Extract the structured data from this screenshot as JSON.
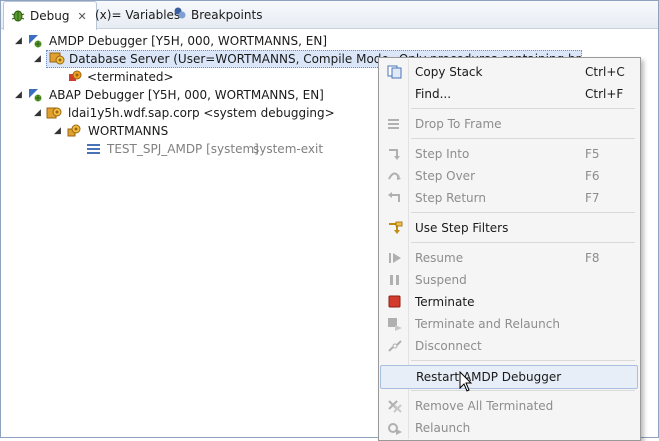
{
  "tabs": [
    {
      "label": "Debug",
      "active": true
    },
    {
      "label": "(x)= Variables",
      "active": false
    },
    {
      "label": "Breakpoints",
      "active": false
    }
  ],
  "tree": {
    "amdp_debugger": "AMDP Debugger [Y5H, 000, WORTMANNS, EN]",
    "database_server": "Database Server (User=WORTMANNS, Compile Mode=Only procedures containing breakpoints)",
    "terminated": "<terminated>",
    "abap_debugger": "ABAP Debugger [Y5H, 000, WORTMANNS, EN]",
    "host": "ldai1y5h.wdf.sap.corp <system debugging>",
    "user_node": "WORTMANNS",
    "frame_name": "TEST_SPJ_AMDP [system]",
    "frame_status": "system-exit"
  },
  "menu": {
    "copy_stack": {
      "label": "Copy Stack",
      "accel": "Ctrl+C"
    },
    "find": {
      "label": "Find...",
      "accel": "Ctrl+F"
    },
    "drop_to_frame": {
      "label": "Drop To Frame"
    },
    "step_into": {
      "label": "Step Into",
      "accel": "F5"
    },
    "step_over": {
      "label": "Step Over",
      "accel": "F6"
    },
    "step_return": {
      "label": "Step Return",
      "accel": "F7"
    },
    "use_step_filters": {
      "label": "Use Step Filters"
    },
    "resume": {
      "label": "Resume",
      "accel": "F8"
    },
    "suspend": {
      "label": "Suspend"
    },
    "terminate": {
      "label": "Terminate"
    },
    "terminate_relaunch": {
      "label": "Terminate and Relaunch"
    },
    "disconnect": {
      "label": "Disconnect"
    },
    "restart_amdp": {
      "label": "Restart AMDP Debugger"
    },
    "remove_all_terminated": {
      "label": "Remove All Terminated"
    },
    "relaunch": {
      "label": "Relaunch"
    }
  },
  "colors": {
    "accent": "#2b63b8",
    "terminate_red": "#d33b2c",
    "menu_bg": "#f5f5f5"
  }
}
